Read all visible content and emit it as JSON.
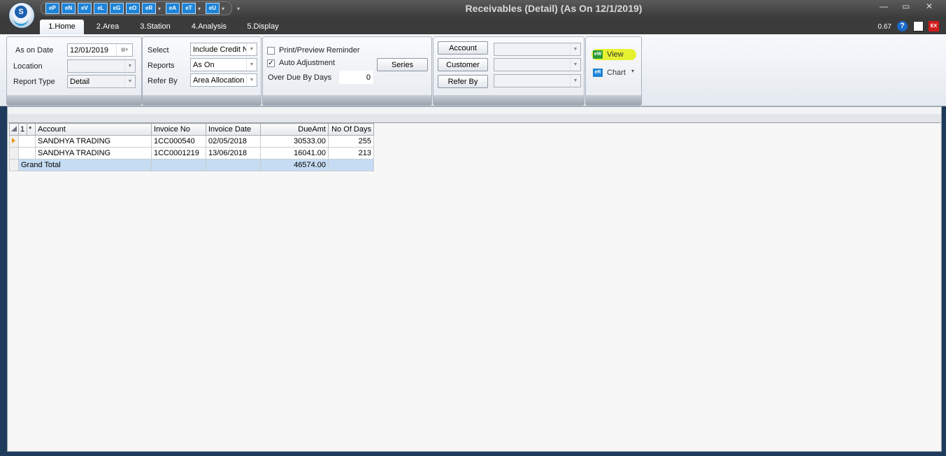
{
  "window": {
    "title": "Receivables (Detail) (As On 12/1/2019)"
  },
  "logo_letter": "S",
  "qat": {
    "buttons": [
      "eP",
      "eN",
      "eV",
      "eL",
      "eG",
      "eO",
      "eR",
      "eA",
      "eT",
      "eU"
    ],
    "overflow": "▾"
  },
  "tabs": [
    "1.Home",
    "2.Area",
    "3.Station",
    "4.Analysis",
    "5.Display"
  ],
  "active_tab": "1.Home",
  "zoom": "0.67",
  "ribbon": {
    "date_group": {
      "as_on_date_label": "As on Date",
      "as_on_date_value": "12/01/2019",
      "location_label": "Location",
      "location_value": "",
      "report_type_label": "Report Type",
      "report_type_value": "Detail"
    },
    "select_group": {
      "select_label": "Select",
      "select_value": "Include Credit N",
      "reports_label": "Reports",
      "reports_value": "As On",
      "refer_by_label": "Refer By",
      "refer_by_value": "Area Allocation"
    },
    "options_group": {
      "print_preview_label": "Print/Preview Reminder",
      "print_preview_checked": false,
      "auto_adjustment_label": "Auto Adjustment",
      "auto_adjustment_checked": true,
      "check_mark": "✓",
      "over_due_label": "Over Due By Days",
      "over_due_value": "0",
      "series_button": "Series"
    },
    "filter_group": {
      "account_button": "Account",
      "customer_button": "Customer",
      "refer_by_button": "Refer By"
    },
    "view_group": {
      "view_icon": "eW",
      "view_label": "View",
      "chart_icon": "eR",
      "chart_label": "Chart",
      "chart_arrow": "▾"
    }
  },
  "grid": {
    "row_indicator_header": "1",
    "sort_marker": "*",
    "columns": [
      "Account",
      "Invoice No",
      "Invoice Date",
      "DueAmt",
      "No Of Days"
    ],
    "rows": [
      {
        "account": "SANDHYA TRADING",
        "invoice_no": "1CC000540",
        "invoice_date": "02/05/2018",
        "due_amt": "30533.00",
        "days": "255"
      },
      {
        "account": "SANDHYA TRADING",
        "invoice_no": "1CC0001219",
        "invoice_date": "13/06/2018",
        "due_amt": "16041.00",
        "days": "213"
      }
    ],
    "total": {
      "label": "Grand Total",
      "due_amt": "46574.00"
    }
  },
  "colors": {
    "accent": "#1e84d8",
    "title_bar": "#4a4a4a",
    "total_row": "#c5dcf2",
    "highlight": "#e6ef1a"
  }
}
